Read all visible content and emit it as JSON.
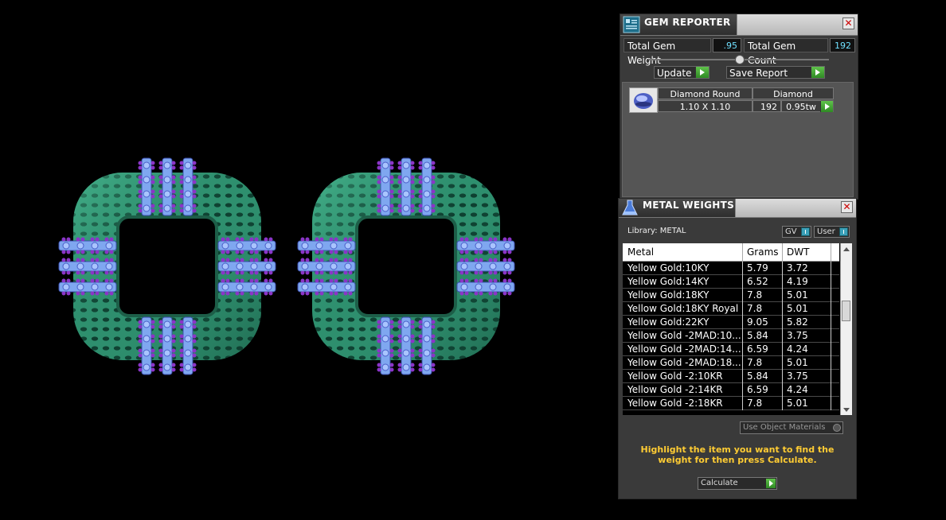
{
  "gem_reporter": {
    "title": "GEM REPORTER",
    "total_weight_label": "Total Gem Weight",
    "total_weight_value": ".95",
    "total_count_label": "Total Gem Count",
    "total_count_value": "192",
    "update_label": "Update",
    "save_report_label": "Save Report",
    "gem": {
      "shape": "Diamond Round",
      "material": "Diamond",
      "size": "1.10 X 1.10",
      "count": "192",
      "weight": "0.95tw"
    }
  },
  "metal_weights": {
    "title": "METAL WEIGHTS",
    "library_label": "Library: METAL",
    "gv_label": "GV",
    "user_label": "User",
    "columns": [
      "Metal",
      "Grams",
      "DWT"
    ],
    "rows": [
      {
        "metal": "Yellow Gold:10KY",
        "grams": "5.79",
        "dwt": "3.72"
      },
      {
        "metal": "Yellow Gold:14KY",
        "grams": "6.52",
        "dwt": "4.19"
      },
      {
        "metal": "Yellow Gold:18KY",
        "grams": "7.8",
        "dwt": "5.01"
      },
      {
        "metal": "Yellow Gold:18KY Royal",
        "grams": "7.8",
        "dwt": "5.01"
      },
      {
        "metal": "Yellow Gold:22KY",
        "grams": "9.05",
        "dwt": "5.82"
      },
      {
        "metal": "Yellow Gold -2MAD:10...",
        "grams": "5.84",
        "dwt": "3.75"
      },
      {
        "metal": "Yellow Gold -2MAD:14...",
        "grams": "6.59",
        "dwt": "4.24"
      },
      {
        "metal": "Yellow Gold -2MAD:18...",
        "grams": "7.8",
        "dwt": "5.01"
      },
      {
        "metal": "Yellow Gold -2:10KR",
        "grams": "5.84",
        "dwt": "3.75"
      },
      {
        "metal": "Yellow Gold -2:14KR",
        "grams": "6.59",
        "dwt": "4.24"
      },
      {
        "metal": "Yellow Gold -2:18KR",
        "grams": "7.8",
        "dwt": "5.01"
      }
    ],
    "use_object_materials_label": "Use Object Materials",
    "hint": "Highlight the item you want to find the weight for then press Calculate.",
    "calculate_label": "Calculate"
  },
  "colors": {
    "metal_green": "#2e8f6e",
    "gem_blue": "#7fa7f0",
    "prong_purple": "#8a35c8",
    "hint_yellow": "#ffcc33",
    "value_cyan": "#6fe0ff"
  }
}
